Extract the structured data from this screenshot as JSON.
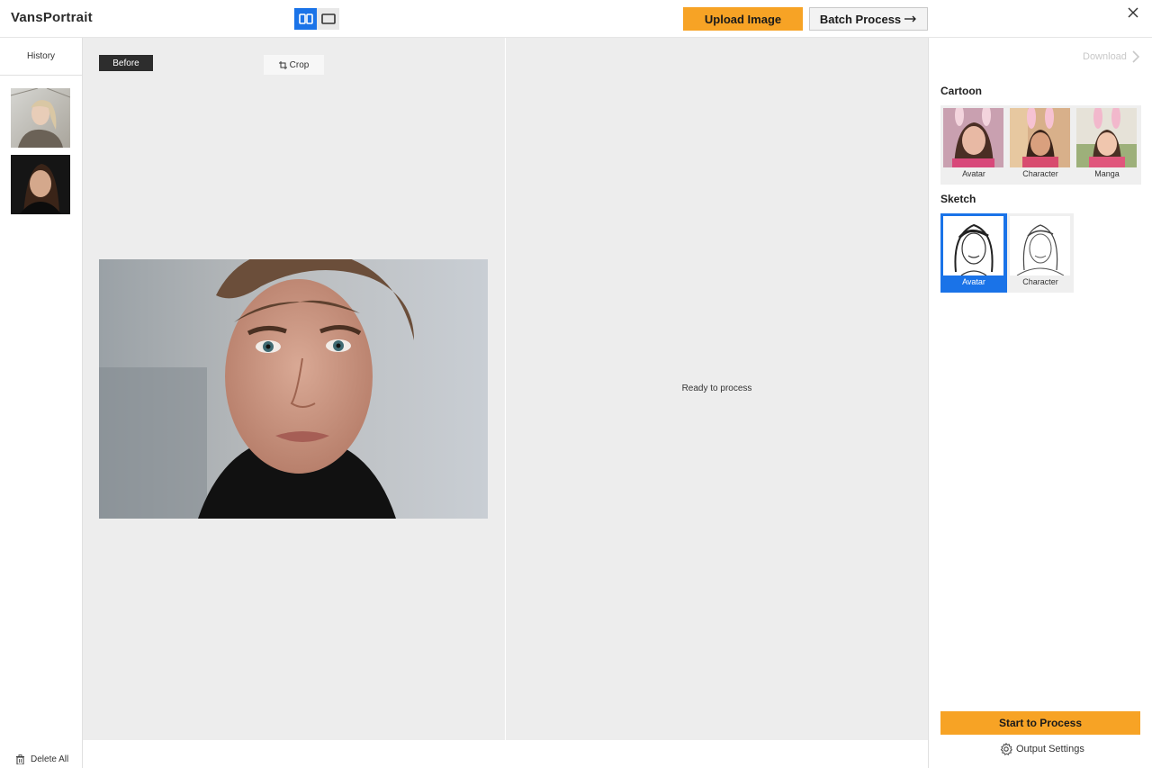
{
  "app": {
    "title": "VansPortrait"
  },
  "toolbar": {
    "upload_label": "Upload Image",
    "batch_label": "Batch Process",
    "view_modes": [
      "split-view",
      "single-view"
    ],
    "active_view": "split-view"
  },
  "history": {
    "label": "History",
    "items": [
      "photo-blonde-woman",
      "photo-dark-hair-woman"
    ],
    "delete_all_label": "Delete All"
  },
  "canvas": {
    "before_label": "Before",
    "crop_label": "Crop",
    "ready_text": "Ready to process"
  },
  "styles": {
    "download_label": "Download",
    "cartoon": {
      "title": "Cartoon",
      "items": [
        {
          "label": "Avatar"
        },
        {
          "label": "Character"
        },
        {
          "label": "Manga"
        }
      ]
    },
    "sketch": {
      "title": "Sketch",
      "items": [
        {
          "label": "Avatar",
          "selected": true
        },
        {
          "label": "Character",
          "selected": false
        }
      ]
    },
    "start_label": "Start to Process",
    "output_settings_label": "Output Settings"
  },
  "colors": {
    "accent_orange": "#f7a325",
    "accent_blue": "#1a73e8",
    "canvas_bg": "#ededed"
  }
}
